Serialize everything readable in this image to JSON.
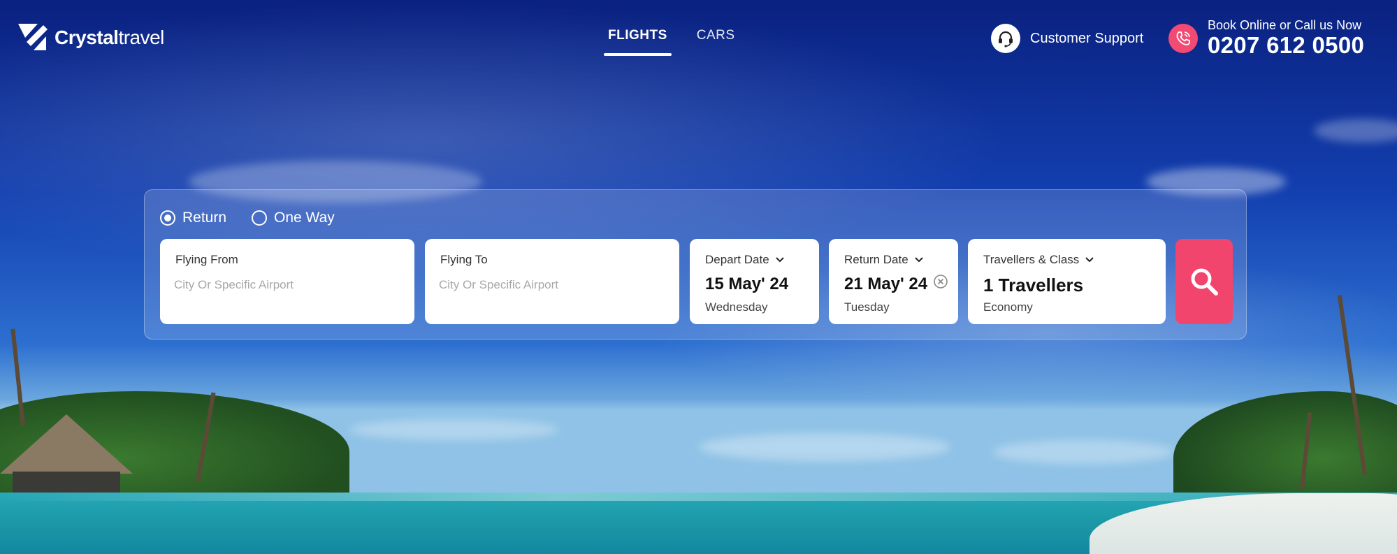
{
  "brand": {
    "bold": "Crystal",
    "light": "travel"
  },
  "nav": {
    "tabs": [
      {
        "label": "FLIGHTS",
        "active": true
      },
      {
        "label": "CARS",
        "active": false
      }
    ]
  },
  "header": {
    "support_label": "Customer Support",
    "call_caption": "Book Online or Call us Now",
    "call_number": "0207 612 0500",
    "support_icon": "headset-icon",
    "call_icon": "phone-icon"
  },
  "search": {
    "trip_types": [
      {
        "label": "Return",
        "checked": true
      },
      {
        "label": "One Way",
        "checked": false
      }
    ],
    "from": {
      "label": "Flying From",
      "placeholder": "City Or Specific Airport",
      "value": ""
    },
    "to": {
      "label": "Flying To",
      "placeholder": "City Or Specific Airport",
      "value": ""
    },
    "depart": {
      "label": "Depart Date",
      "value": "15 May' 24",
      "day": "Wednesday"
    },
    "return": {
      "label": "Return Date",
      "value": "21 May' 24",
      "day": "Tuesday"
    },
    "travellers": {
      "label": "Travellers & Class",
      "value": "1 Travellers",
      "class": "Economy"
    },
    "search_icon": "magnifier-icon"
  },
  "colors": {
    "accent": "#f2456d",
    "panel_bg": "rgba(255,255,255,0.16)",
    "sky": "#1340b0"
  }
}
